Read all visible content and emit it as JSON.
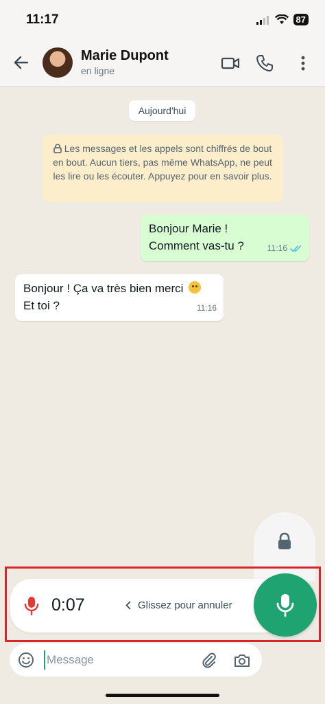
{
  "status_bar": {
    "time": "11:17",
    "battery": "87"
  },
  "header": {
    "contact_name": "Marie Dupont",
    "contact_status": "en ligne"
  },
  "chat": {
    "date_label": "Aujourd'hui",
    "encryption_notice": "Les messages et les appels sont chiffrés de bout en bout. Aucun tiers, pas même WhatsApp, ne peut les lire ou les écouter. Appuyez pour en savoir plus.",
    "messages": [
      {
        "direction": "outgoing",
        "text": "Bonjour Marie !\nComment vas-tu ?",
        "time": "11:16",
        "status": "read"
      },
      {
        "direction": "incoming",
        "text_line1": "Bonjour ! Ça va très bien merci",
        "text_line2": "Et toi ?",
        "emoji": "smiling-face",
        "time": "11:16"
      }
    ]
  },
  "recording": {
    "timer": "0:07",
    "slide_to_cancel": "Glissez pour annuler"
  },
  "input": {
    "placeholder": "Message"
  },
  "colors": {
    "accent_green": "#1fa371",
    "outgoing_bubble": "#d9fdd3",
    "recording_red": "#e53935",
    "read_ticks": "#53bdeb",
    "highlight_frame": "#d9242c"
  },
  "icons": [
    "back-arrow-icon",
    "video-call-icon",
    "phone-icon",
    "more-options-icon",
    "lock-icon",
    "microphone-icon",
    "chevron-left-icon",
    "emoji-icon",
    "attach-icon",
    "camera-icon",
    "double-check-icon",
    "signal-icon",
    "wifi-icon"
  ]
}
